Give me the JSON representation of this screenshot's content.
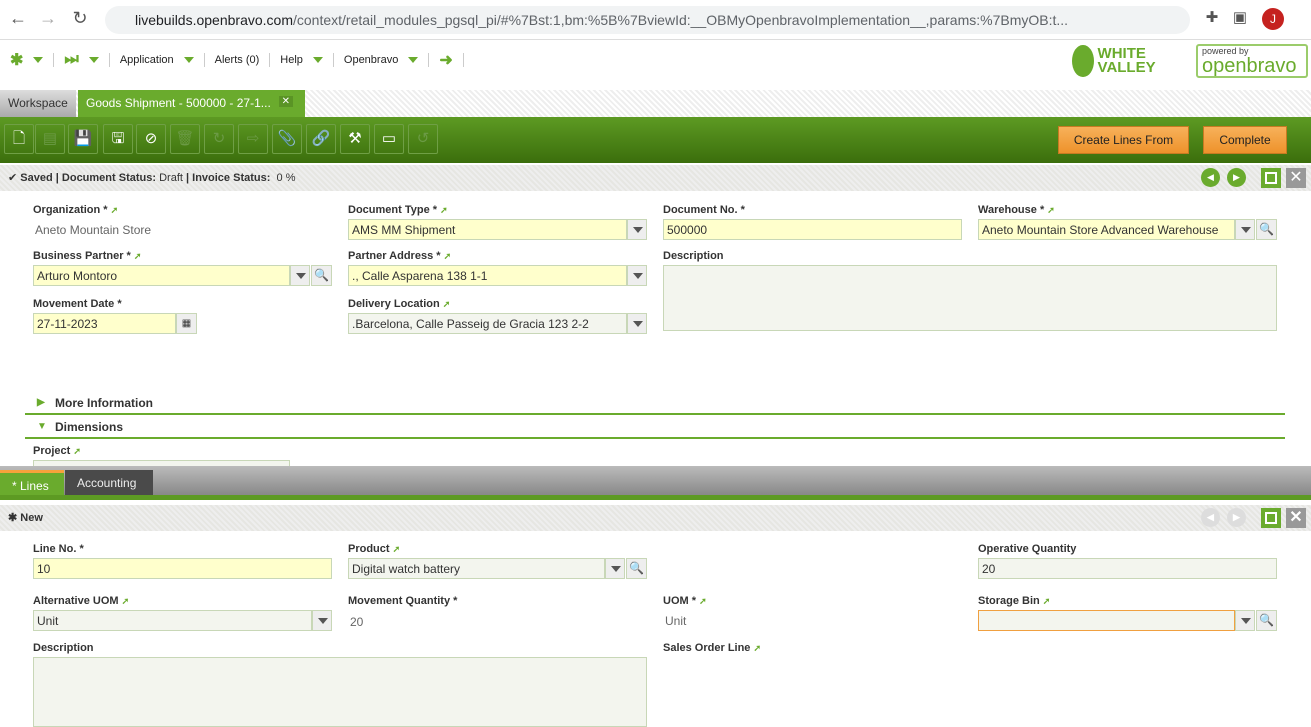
{
  "browser": {
    "url_host": "livebuilds.openbravo.com",
    "url_path": "/context/retail_modules_pgsql_pi/#%7Bst:1,bm:%5B%7BviewId:__OBMyOpenbravoImplementation__,params:%7BmyOB:t...",
    "avatar": "J"
  },
  "nav": {
    "application": "Application",
    "alerts": "Alerts (0)",
    "help": "Help",
    "user": "Openbravo"
  },
  "logos": {
    "white_valley": "WHITE VALLEY",
    "powered": "powered by",
    "openbravo": "openbravo"
  },
  "tabs": {
    "workspace": "Workspace",
    "active": "Goods Shipment - 500000 - 27-1..."
  },
  "toolbar": {
    "create_lines": "Create Lines From",
    "complete": "Complete"
  },
  "status": {
    "saved": "Saved",
    "doc_status_label": "Document Status:",
    "doc_status": "Draft",
    "inv_status_label": "Invoice Status:",
    "inv_status": "0 %"
  },
  "header": {
    "organization": {
      "label": "Organization *",
      "value": "Aneto Mountain Store"
    },
    "document_type": {
      "label": "Document Type *",
      "value": "AMS MM Shipment"
    },
    "document_no": {
      "label": "Document No. *",
      "value": "500000"
    },
    "warehouse": {
      "label": "Warehouse *",
      "value": "Aneto Mountain Store Advanced Warehouse"
    },
    "business_partner": {
      "label": "Business Partner *",
      "value": "Arturo Montoro"
    },
    "partner_address": {
      "label": "Partner Address *",
      "value": "., Calle Asparena 138 1-1"
    },
    "description": {
      "label": "Description",
      "value": ""
    },
    "movement_date": {
      "label": "Movement Date *",
      "value": "27-11-2023"
    },
    "delivery_location": {
      "label": "Delivery Location",
      "value": ".Barcelona, Calle Passeig de Gracia 123 2-2"
    },
    "more_info": "More Information",
    "dimensions": "Dimensions",
    "project": {
      "label": "Project",
      "value": ""
    }
  },
  "lines_tabs": {
    "lines": "* Lines",
    "accounting": "Accounting"
  },
  "lines": {
    "state": "New",
    "line_no": {
      "label": "Line No. *",
      "value": "10"
    },
    "product": {
      "label": "Product",
      "value": "Digital watch battery"
    },
    "operative_qty": {
      "label": "Operative Quantity",
      "value": "20"
    },
    "alt_uom": {
      "label": "Alternative UOM",
      "value": "Unit"
    },
    "movement_qty": {
      "label": "Movement Quantity *",
      "value": "20"
    },
    "uom": {
      "label": "UOM *",
      "value": "Unit"
    },
    "storage_bin": {
      "label": "Storage Bin",
      "value": ""
    },
    "description": {
      "label": "Description",
      "value": ""
    },
    "sales_order_line": {
      "label": "Sales Order Line",
      "value": ""
    }
  }
}
